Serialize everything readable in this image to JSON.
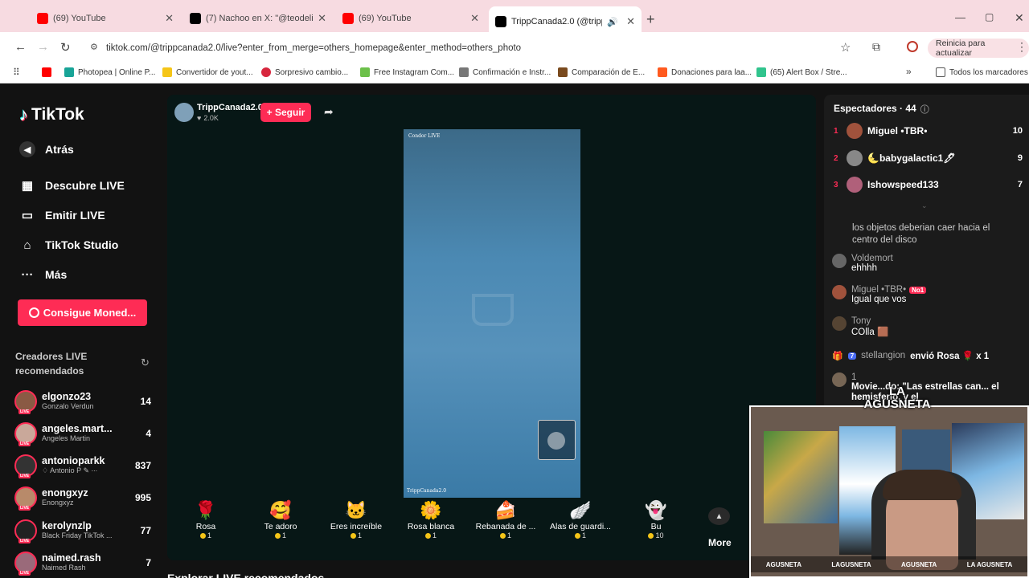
{
  "browser": {
    "tabs": [
      {
        "title": "(69) YouTube",
        "icon_color": "#ff0000"
      },
      {
        "title": "(7) Nachoo en X: \"@teodeliaa @",
        "icon_color": "#000000"
      },
      {
        "title": "(69) YouTube",
        "icon_color": "#ff0000"
      },
      {
        "title": "TrippCanada2.0 (@trippcan",
        "icon_color": "#000000"
      }
    ],
    "new_tab": "+",
    "url": "tiktok.com/@trippcanada2.0/live?enter_from_merge=others_homepage&enter_method=others_photo",
    "update_button": "Reinicia para actualizar",
    "bookmarks": [
      {
        "label": "",
        "icon_color": "#ff0000"
      },
      {
        "label": "Photopea | Online P...",
        "icon_color": "#18a497"
      },
      {
        "label": "Convertidor de yout...",
        "icon_color": "#f5c518"
      },
      {
        "label": "Sorpresivo cambio...",
        "icon_color": "#d7263d"
      },
      {
        "label": "Free Instagram Com...",
        "icon_color": "#6cc04a"
      },
      {
        "label": "Confirmación e Instr...",
        "icon_color": "#777777"
      },
      {
        "label": "Comparación de E...",
        "icon_color": "#7a4a1e"
      },
      {
        "label": "Donaciones para laa...",
        "icon_color": "#ff5a1f"
      },
      {
        "label": "(65) Alert Box / Stre...",
        "icon_color": "#31c48d"
      }
    ],
    "all_bookmarks": "Todos los marcadores"
  },
  "sidebar": {
    "logo": "TikTok",
    "back": "Atrás",
    "nav": [
      {
        "label": "Descubre LIVE",
        "icon": "calendar-icon"
      },
      {
        "label": "Emitir LIVE",
        "icon": "video-icon"
      },
      {
        "label": "TikTok Studio",
        "icon": "home-icon"
      },
      {
        "label": "Más",
        "icon": "more-icon"
      }
    ],
    "coins_button": "Consigue Moned...",
    "creators_heading_1": "Creadores LIVE",
    "creators_heading_2": "recomendados",
    "creators": [
      {
        "name": "elgonzo23",
        "sub": "Gonzalo Verdun",
        "count": "14",
        "color": "#8a5a44"
      },
      {
        "name": "angeles.mart...",
        "sub": "Angeles Martin",
        "count": "4",
        "color": "#c9a89a"
      },
      {
        "name": "antonioparkk",
        "sub": "♢ Antonio P ✎ ∙∙∙",
        "count": "837",
        "color": "#333333"
      },
      {
        "name": "enongxyz",
        "sub": "Enongxyz",
        "count": "995",
        "color": "#b88a6a"
      },
      {
        "name": "kerolynzlp",
        "sub": "Black Friday TikTok ...",
        "count": "77",
        "color": "#222222"
      },
      {
        "name": "naimed.rash",
        "sub": "Naimed Rash",
        "count": "7",
        "color": "#9a6a7a"
      }
    ]
  },
  "stream": {
    "host_name": "TrippCanada2.0",
    "likes": "2.0K",
    "follow_button": "+ Seguir",
    "video_top_label": "Condor LIVE",
    "video_bottom_label": "TrippCanada2.0",
    "gifts": [
      {
        "name": "Rosa",
        "price": "1",
        "icon": "🌹"
      },
      {
        "name": "Te adoro",
        "price": "1",
        "icon": "🥰"
      },
      {
        "name": "Eres increíble",
        "price": "1",
        "icon": "🐱"
      },
      {
        "name": "Rosa blanca",
        "price": "1",
        "icon": "🌼"
      },
      {
        "name": "Rebanada de ...",
        "price": "1",
        "icon": "🍰"
      },
      {
        "name": "Alas de guardi...",
        "price": "1",
        "icon": "🪽"
      },
      {
        "name": "Bu",
        "price": "10",
        "icon": "👻"
      }
    ],
    "more_button": "More",
    "bottom_heading": "Explorar LIVE recomendados"
  },
  "viewers_panel": {
    "title": "Espectadores · 44",
    "viewers": [
      {
        "rank": "1",
        "name": "Miguel •TBR•",
        "count": "10",
        "color": "#a0523c"
      },
      {
        "rank": "2",
        "name": "🌜babygalactic1🖊",
        "count": "9",
        "color": "#888888"
      },
      {
        "rank": "3",
        "name": "Ishowspeed133",
        "count": "7",
        "color": "#b0607a"
      }
    ]
  },
  "chat": [
    {
      "user": "",
      "text": "los objetos deberian caer hacia el centro del disco"
    },
    {
      "user": "Voldemort",
      "text": "ehhhh"
    },
    {
      "user": "Miguel •TBR•",
      "badge": "No1",
      "text": "Igual que vos"
    },
    {
      "user": "Tony",
      "text": "COlla 🟫"
    },
    {
      "user": "stellangion",
      "level": "7",
      "text": "envió Rosa 🌹 x 1"
    },
    {
      "user": "1",
      "text": "Movie...do: \"Las estrellas can... el hemisferio, y el"
    }
  ],
  "webcam_overlay": {
    "watermark": "LA AGUSNETA",
    "socials": [
      "AGUSNETA",
      "LAGUSNETA",
      "AGUSNETA",
      "LA AGUSNETA"
    ]
  },
  "colors": {
    "accent": "#fe2c55",
    "bg": "#121212",
    "chrome_tabs": "#f7dbe1"
  }
}
